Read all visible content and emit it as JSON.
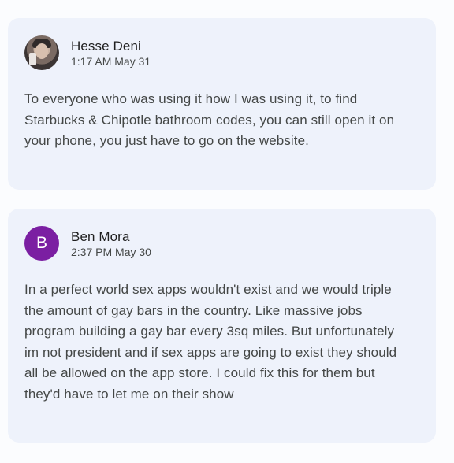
{
  "posts": [
    {
      "author": "Hesse Deni",
      "timestamp": "1:17 AM May 31",
      "avatar": {
        "type": "photo",
        "icon": "user-photo"
      },
      "text": "To everyone who was using it how I was using it, to find Starbucks & Chipotle bathroom codes, you can still open it on your phone, you just have to go on the website."
    },
    {
      "author": "Ben Mora",
      "timestamp": "2:37 PM May 30",
      "avatar": {
        "type": "letter",
        "letter": "B",
        "color": "#7b1fa2"
      },
      "text": "In a perfect world sex apps wouldn't exist and we would triple the amount of gay bars in the country. Like massive jobs program building a gay bar every 3sq miles. But unfortunately im not president and if sex apps are going to exist they should all be allowed on the app store. I could fix this for them but they'd have to let me on their show"
    }
  ],
  "colors": {
    "card_background": "#eef2fb",
    "name_text": "#1f1f1f",
    "secondary_text": "#444746"
  }
}
